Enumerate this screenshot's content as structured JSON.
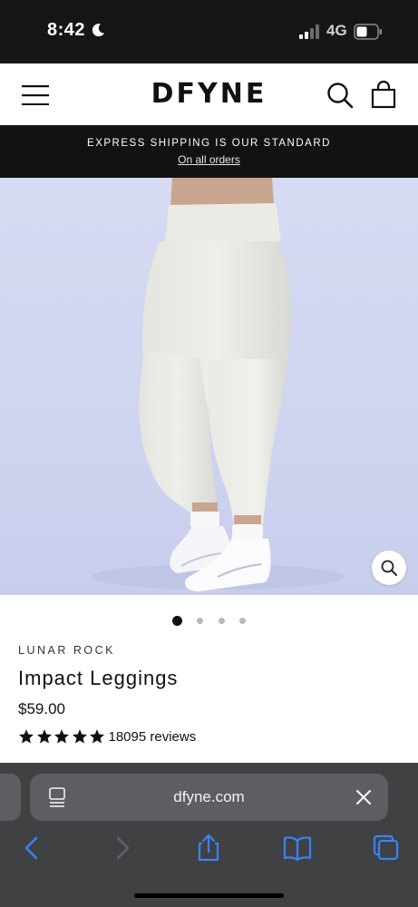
{
  "status_bar": {
    "time": "8:42",
    "network": "4G",
    "icons": [
      "moon-icon",
      "signal-icon",
      "battery-icon"
    ]
  },
  "header": {
    "brand": "DFYNE",
    "icons": [
      "menu-icon",
      "search-icon",
      "cart-icon"
    ]
  },
  "announcement": {
    "text": "EXPRESS SHIPPING IS OUR STANDARD",
    "link": "On all orders"
  },
  "gallery": {
    "slide_count": 4,
    "active_index": 0,
    "zoom_icon": "zoom-icon"
  },
  "product": {
    "color": "LUNAR ROCK",
    "title": "Impact Leggings",
    "price": "$59.00",
    "rating": 5,
    "reviews": "18095 reviews"
  },
  "browser": {
    "url": "dfyne.com",
    "toolbar": [
      "back-icon",
      "forward-icon",
      "share-icon",
      "bookmarks-icon",
      "tabs-icon"
    ]
  },
  "colors": {
    "announcement_bg": "#121212",
    "image_bg": "#d6daf2",
    "safari_bar": "#404143",
    "toolbar_accent": "#3b82f6"
  }
}
